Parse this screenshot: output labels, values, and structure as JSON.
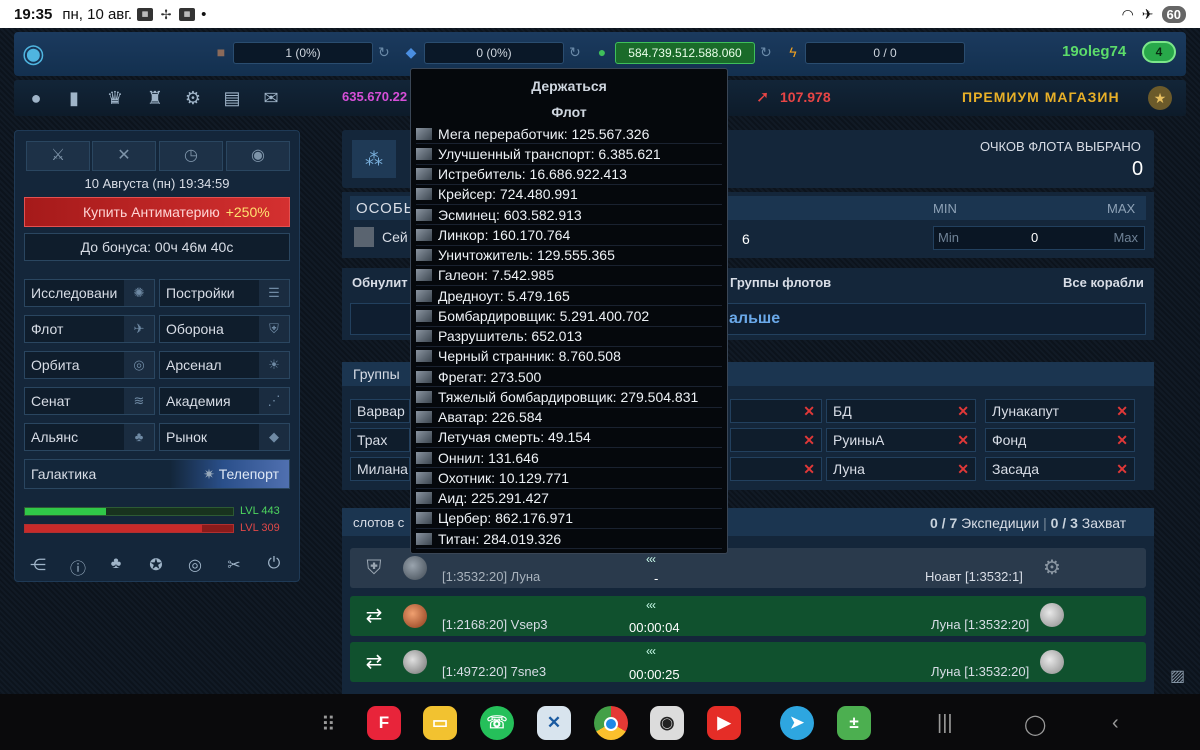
{
  "status": {
    "time": "19:35",
    "date": "пн, 10 авг.",
    "battery": "60"
  },
  "resources": {
    "metal": "1 (0%)",
    "crystal": "0 (0%)",
    "deuterium": "584.739.512.588.060",
    "energy": "0 / 0"
  },
  "player": {
    "name": "19oleg74",
    "level": "4"
  },
  "topstats": {
    "pink_value": "635.670.22",
    "red_value": "107.978",
    "premium_label": "ПРЕМИУМ МАГАЗИН"
  },
  "sidebar": {
    "datetime": "10 Августа (пн) 19:34:59",
    "buy_anti": "Купить Антиматерию",
    "buy_bonus": "+250%",
    "to_bonus": "До бонуса: 00ч 46м 40с",
    "menu": [
      {
        "label": "Исследовани"
      },
      {
        "label": "Постройки"
      },
      {
        "label": "Флот"
      },
      {
        "label": "Оборона"
      },
      {
        "label": "Орбита"
      },
      {
        "label": "Арсенал"
      },
      {
        "label": "Сенат"
      },
      {
        "label": "Академия"
      },
      {
        "label": "Альянс"
      },
      {
        "label": "Рынок"
      }
    ],
    "galaxy": "Галактика",
    "teleport": "Телепорт",
    "lvl_green": "LVL 443",
    "lvl_green_fill": 0.39,
    "lvl_red": "LVL 309",
    "lvl_red_fill": 0.85
  },
  "fleet": {
    "points_label": "ОЧКОВ ФЛОТА ВЫБРАНО",
    "points_value": "0",
    "special_label": "ОСОБЬ",
    "min_label": "MIN",
    "max_label": "MAX",
    "row_name": "Сей",
    "row_count": "6",
    "min_placeholder": "Min",
    "min_value": "0",
    "max_placeholder": "Max",
    "reset_label": "Обнулит",
    "groups_label": "Группы флотов",
    "all_ships_label": "Все корабли",
    "next_label": "альше"
  },
  "groups": {
    "title": "Группы",
    "items": [
      {
        "label": "Варвар"
      },
      {
        "label": "БД"
      },
      {
        "label": "Лунакапут"
      },
      {
        "label": "Трах"
      },
      {
        "label": "РуиныА"
      },
      {
        "label": "Фонд"
      },
      {
        "label": "Милана"
      },
      {
        "label": "Луна"
      },
      {
        "label": "Засада"
      }
    ]
  },
  "expeditions": {
    "title": "слотов с",
    "exp_count": "0 / 7",
    "exp_label": "Экспедиции",
    "capture_count": "0 / 3",
    "capture_label": "Захват",
    "missions": [
      {
        "from": "[1:3532:20] Луна",
        "time": "-",
        "to": "Ноавт [1:3532:1]",
        "chev": "‹‹‹"
      },
      {
        "from": "[1:2168:20] Vsep3",
        "time": "00:00:04",
        "to": "Луна [1:3532:20]",
        "chev": "‹‹‹"
      },
      {
        "from": "[1:4972:20] 7sne3",
        "time": "00:00:25",
        "to": "Луна [1:3532:20]",
        "chev": "‹‹‹"
      }
    ]
  },
  "tooltip": {
    "title": "Держаться",
    "subtitle": "Флот",
    "ships": [
      "Мега переработчик: 125.567.326",
      "Улучшенный транспорт: 6.385.621",
      "Истребитель: 16.686.922.413",
      "Крейсер: 724.480.991",
      "Эсминец: 603.582.913",
      "Линкор: 160.170.764",
      "Уничтожитель: 129.555.365",
      "Галеон: 7.542.985",
      "Дредноут: 5.479.165",
      "Бомбардировщик: 5.291.400.702",
      "Разрушитель: 652.013",
      "Черный странник: 8.760.508",
      "Фрегат: 273.500",
      "Тяжелый бомбардировщик: 279.504.831",
      "Аватар: 226.584",
      "Летучая смерть: 49.154",
      "Оннил: 131.646",
      "Охотник: 10.129.771",
      "Аид: 225.291.427",
      "Цербер: 862.176.971",
      "Титан: 284.019.326"
    ]
  }
}
